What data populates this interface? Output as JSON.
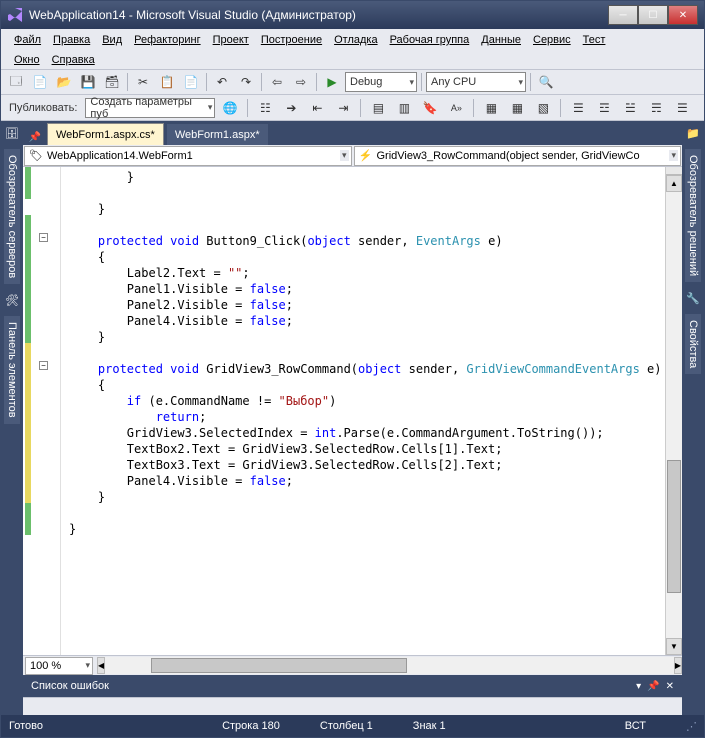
{
  "window": {
    "title": "WebApplication14 - Microsoft Visual Studio (Администратор)"
  },
  "menus": {
    "file": "Файл",
    "edit": "Правка",
    "view": "Вид",
    "refactoring": "Рефакторинг",
    "project": "Проект",
    "build": "Построение",
    "debug": "Отладка",
    "team": "Рабочая группа",
    "data": "Данные",
    "service": "Сервис",
    "test": "Тест",
    "window": "Окно",
    "help": "Справка"
  },
  "toolbar": {
    "config": "Debug",
    "platform": "Any CPU",
    "publish_label": "Публиковать:",
    "publish_target": "Создать параметры пуб"
  },
  "sidebars": {
    "left1": "Обозреватель серверов",
    "left2": "Панель элементов",
    "right1": "Обозреватель решений",
    "right2": "Свойства"
  },
  "tabs": {
    "active": "WebForm1.aspx.cs*",
    "inactive": "WebForm1.aspx*"
  },
  "nav": {
    "class": "WebApplication14.WebForm1",
    "member": "GridView3_RowCommand(object sender, GridViewCo"
  },
  "zoom": "100 %",
  "error_panel": {
    "title": "Список ошибок"
  },
  "status": {
    "ready": "Готово",
    "line": "Строка 180",
    "col": "Столбец 1",
    "char": "Знак 1",
    "ins": "ВСТ"
  },
  "code": {
    "lines": [
      "        }",
      "",
      "    }",
      "",
      "    protected void Button9_Click(object sender, EventArgs e)",
      "    {",
      "        Label2.Text = \"\";",
      "        Panel1.Visible = false;",
      "        Panel2.Visible = false;",
      "        Panel4.Visible = false;",
      "    }",
      "",
      "    protected void GridView3_RowCommand(object sender, GridViewCommandEventArgs e)",
      "    {",
      "        if (e.CommandName != \"Выбор\")",
      "            return;",
      "        GridView3.SelectedIndex = int.Parse(e.CommandArgument.ToString());",
      "        TextBox2.Text = GridView3.SelectedRow.Cells[1].Text;",
      "        TextBox3.Text = GridView3.SelectedRow.Cells[2].Text;",
      "        Panel4.Visible = false;",
      "    }",
      "",
      "}"
    ]
  }
}
